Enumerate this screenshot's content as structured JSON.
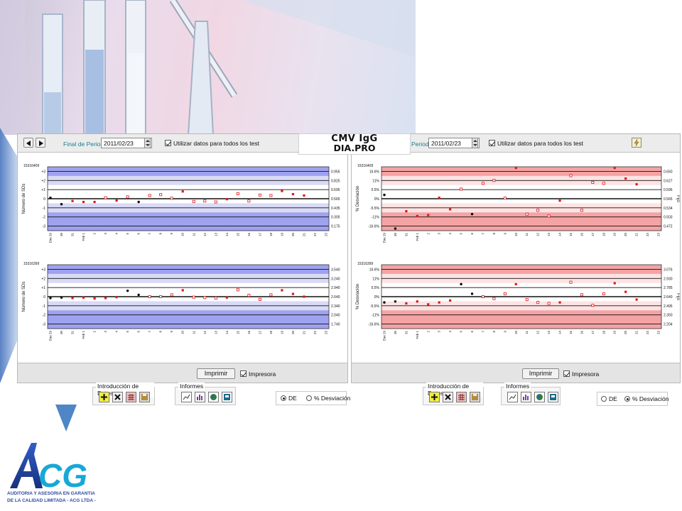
{
  "product": {
    "line1": "CMV IgG",
    "line2": "DIA.PRO"
  },
  "left_window": {
    "period_label": "Final de Periodo",
    "date_value": "2011/02/23",
    "use_all_label": "Utilizar datos para todos los test",
    "print_label": "Imprimir",
    "printer_label": "Impresora",
    "data_entry_title": "Introducción de Datos",
    "reports_title": "Informes",
    "radio_de": "DE",
    "radio_pct": "% Desviación",
    "selected_mode": "DE"
  },
  "right_window": {
    "period_label": "Periodo",
    "date_value": "2011/02/23",
    "use_all_label": "Utilizar datos para todos los test",
    "print_label": "Imprimir",
    "printer_label": "Impresora",
    "data_entry_title": "Introducción de Datos",
    "reports_title": "Informes",
    "radio_de": "DE",
    "radio_pct": "% Desviación",
    "selected_mode": "% Desviación"
  },
  "icons": {
    "prev": "arrow-left-icon",
    "next": "arrow-right-icon",
    "lightning": "lightning-icon",
    "add": "add-icon",
    "delete": "delete-icon",
    "grid": "grid-icon",
    "save": "save-icon",
    "chart": "line-chart-icon",
    "bar": "bar-chart-icon",
    "globe": "globe-icon",
    "report": "report-icon"
  },
  "colors": {
    "blue_band_dark": "#9ea2ef",
    "blue_band_light": "#d9daf6",
    "red_band": "#f4a3a4",
    "red_band_light": "#fde3e3",
    "point_red": "#e01818",
    "point_black": "#000000"
  },
  "logo": {
    "text": "ACG",
    "sub1": "AUDITORIA Y ASESORIA EN GARANTIA",
    "sub2": "DE LA CALIDAD LIMITADA - ACG LTDA -"
  },
  "chart_data": [
    {
      "type": "scatter",
      "panel": "left-top",
      "corner_label": "15316409",
      "ylabel": "Número de SDs",
      "y_ticks": [
        "+3",
        "+2",
        "+1",
        "0",
        "-1",
        "-2",
        "-3"
      ],
      "right_ticks": [
        "0.955",
        "0.825",
        "0.695",
        "0.565",
        "0.435",
        "0.305",
        "0.175"
      ],
      "x_ticks": [
        "Ene 29",
        "30",
        "31",
        "Feb 1",
        "2",
        "3",
        "4",
        "5",
        "6",
        "7",
        "8",
        "9",
        "10",
        "11",
        "12",
        "13",
        "14",
        "15",
        "16",
        "17",
        "18",
        "19",
        "20",
        "21",
        "22",
        "23"
      ],
      "ylim": [
        -3.5,
        3.5
      ],
      "points": [
        {
          "x": 0,
          "y": 0.1,
          "style": "black"
        },
        {
          "x": 1,
          "y": -0.6,
          "style": "black"
        },
        {
          "x": 2,
          "y": -0.25,
          "style": "red-filled"
        },
        {
          "x": 3,
          "y": -0.35,
          "style": "red-filled"
        },
        {
          "x": 4,
          "y": -0.35,
          "style": "red-filled"
        },
        {
          "x": 5,
          "y": 0.1,
          "style": "red-open"
        },
        {
          "x": 6,
          "y": -0.2,
          "style": "red-filled"
        },
        {
          "x": 7,
          "y": 0.2,
          "style": "red-open"
        },
        {
          "x": 8,
          "y": -0.35,
          "style": "black"
        },
        {
          "x": 9,
          "y": 0.35,
          "style": "red-open"
        },
        {
          "x": 10,
          "y": 0.45,
          "style": "red-open"
        },
        {
          "x": 11,
          "y": 0.05,
          "style": "red-open"
        },
        {
          "x": 12,
          "y": 0.8,
          "style": "red-filled"
        },
        {
          "x": 13,
          "y": -0.3,
          "style": "red-open"
        },
        {
          "x": 14,
          "y": -0.25,
          "style": "red-open"
        },
        {
          "x": 15,
          "y": -0.35,
          "style": "red-open"
        },
        {
          "x": 16,
          "y": -0.05,
          "style": "red-filled"
        },
        {
          "x": 17,
          "y": 0.55,
          "style": "red-open"
        },
        {
          "x": 18,
          "y": -0.25,
          "style": "red-open"
        },
        {
          "x": 19,
          "y": 0.4,
          "style": "red-open"
        },
        {
          "x": 20,
          "y": 0.35,
          "style": "red-open"
        },
        {
          "x": 21,
          "y": 0.85,
          "style": "red-filled"
        },
        {
          "x": 22,
          "y": 0.5,
          "style": "red-filled"
        },
        {
          "x": 23,
          "y": 0.35,
          "style": "red-filled"
        }
      ]
    },
    {
      "type": "scatter",
      "panel": "left-bottom",
      "corner_label": "15316399",
      "ylabel": "Número de SDs",
      "y_ticks": [
        "+3",
        "+2",
        "+1",
        "0",
        "-1",
        "-2",
        "-3"
      ],
      "right_ticks": [
        "3.540",
        "3.240",
        "2.940",
        "2.640",
        "2.340",
        "2.040",
        "1.740"
      ],
      "x_ticks": [
        "Ene 29",
        "30",
        "31",
        "Feb 1",
        "2",
        "3",
        "4",
        "5",
        "6",
        "7",
        "8",
        "9",
        "10",
        "11",
        "12",
        "13",
        "14",
        "15",
        "16",
        "17",
        "18",
        "19",
        "20",
        "21",
        "22",
        "23"
      ],
      "ylim": [
        -3.5,
        3.5
      ],
      "points": [
        {
          "x": 0,
          "y": -0.15,
          "style": "black"
        },
        {
          "x": 1,
          "y": -0.1,
          "style": "black"
        },
        {
          "x": 2,
          "y": -0.15,
          "style": "red-filled"
        },
        {
          "x": 3,
          "y": -0.1,
          "style": "red-filled"
        },
        {
          "x": 4,
          "y": -0.2,
          "style": "red-filled"
        },
        {
          "x": 5,
          "y": -0.15,
          "style": "red-filled"
        },
        {
          "x": 6,
          "y": -0.05,
          "style": "red-filled"
        },
        {
          "x": 7,
          "y": 0.65,
          "style": "black"
        },
        {
          "x": 8,
          "y": 0.2,
          "style": "black"
        },
        {
          "x": 9,
          "y": 0.0,
          "style": "red-open"
        },
        {
          "x": 10,
          "y": 0.0,
          "style": "red-open"
        },
        {
          "x": 11,
          "y": 0.2,
          "style": "red-open"
        },
        {
          "x": 12,
          "y": 0.7,
          "style": "red-filled"
        },
        {
          "x": 13,
          "y": -0.05,
          "style": "red-open"
        },
        {
          "x": 14,
          "y": -0.1,
          "style": "red-open"
        },
        {
          "x": 15,
          "y": -0.15,
          "style": "red-open"
        },
        {
          "x": 16,
          "y": -0.1,
          "style": "red-filled"
        },
        {
          "x": 17,
          "y": 0.75,
          "style": "red-open"
        },
        {
          "x": 18,
          "y": 0.15,
          "style": "red-open"
        },
        {
          "x": 19,
          "y": -0.3,
          "style": "red-open"
        },
        {
          "x": 20,
          "y": 0.2,
          "style": "red-open"
        },
        {
          "x": 21,
          "y": 0.7,
          "style": "red-filled"
        },
        {
          "x": 22,
          "y": 0.3,
          "style": "red-filled"
        },
        {
          "x": 23,
          "y": 0.0,
          "style": "red-filled"
        }
      ]
    },
    {
      "type": "scatter",
      "panel": "right-top",
      "corner_label": "15316409",
      "ylabel": "% Desviación",
      "right_axis_label": "Fijo",
      "y_ticks": [
        "16.6%",
        "11%",
        "5.5%",
        "0%",
        "-5.5%",
        "-11%",
        "-16.6%"
      ],
      "right_ticks": [
        "0.650",
        "0.627",
        "0.596",
        "0.565",
        "0.534",
        "0.503",
        "0.472"
      ],
      "x_ticks": [
        "Ene 29",
        "30",
        "31",
        "Feb 1",
        "2",
        "3",
        "4",
        "5",
        "6",
        "7",
        "8",
        "9",
        "10",
        "11",
        "12",
        "13",
        "14",
        "15",
        "16",
        "17",
        "18",
        "19",
        "20",
        "21",
        "22",
        "23"
      ],
      "ylim": [
        -16.6,
        16.6
      ],
      "points": [
        {
          "x": 0,
          "y": 2.0,
          "style": "black"
        },
        {
          "x": 1,
          "y": -15.5,
          "style": "black"
        },
        {
          "x": 2,
          "y": -6.5,
          "style": "red-filled"
        },
        {
          "x": 3,
          "y": -9.0,
          "style": "red-filled"
        },
        {
          "x": 4,
          "y": -8.5,
          "style": "red-filled"
        },
        {
          "x": 5,
          "y": 0.5,
          "style": "red-filled"
        },
        {
          "x": 6,
          "y": -5.5,
          "style": "red-filled"
        },
        {
          "x": 7,
          "y": 5.0,
          "style": "red-open"
        },
        {
          "x": 8,
          "y": -8.0,
          "style": "black"
        },
        {
          "x": 9,
          "y": 8.0,
          "style": "red-open"
        },
        {
          "x": 10,
          "y": 9.5,
          "style": "red-open"
        },
        {
          "x": 11,
          "y": 0.3,
          "style": "red-open"
        },
        {
          "x": 12,
          "y": 16.0,
          "style": "red-filled"
        },
        {
          "x": 13,
          "y": -8.0,
          "style": "red-open"
        },
        {
          "x": 14,
          "y": -6.0,
          "style": "red-open"
        },
        {
          "x": 15,
          "y": -9.0,
          "style": "red-open"
        },
        {
          "x": 16,
          "y": -1.0,
          "style": "red-filled"
        },
        {
          "x": 17,
          "y": 12.0,
          "style": "red-open"
        },
        {
          "x": 18,
          "y": -6.0,
          "style": "red-open"
        },
        {
          "x": 19,
          "y": 8.5,
          "style": "red-open"
        },
        {
          "x": 20,
          "y": 8.0,
          "style": "red-open"
        },
        {
          "x": 21,
          "y": 16.0,
          "style": "red-filled"
        },
        {
          "x": 22,
          "y": 10.5,
          "style": "red-filled"
        },
        {
          "x": 23,
          "y": 7.5,
          "style": "red-filled"
        }
      ]
    },
    {
      "type": "scatter",
      "panel": "right-bottom",
      "corner_label": "15316399",
      "ylabel": "% Desviación",
      "right_axis_label": "Fijo",
      "y_ticks": [
        "16.6%",
        "11%",
        "5.5%",
        "0%",
        "-5.5%",
        "-11%",
        "-16.6%"
      ],
      "right_ticks": [
        "3.076",
        "2.930",
        "2.785",
        "2.640",
        "2.495",
        "2.350",
        "2.204"
      ],
      "x_ticks": [
        "Ene 29",
        "30",
        "31",
        "Feb 1",
        "2",
        "3",
        "4",
        "5",
        "6",
        "7",
        "8",
        "9",
        "10",
        "11",
        "12",
        "13",
        "14",
        "15",
        "16",
        "17",
        "18",
        "19",
        "20",
        "21",
        "22",
        "23"
      ],
      "ylim": [
        -16.6,
        16.6
      ],
      "points": [
        {
          "x": 0,
          "y": -3.0,
          "style": "black"
        },
        {
          "x": 1,
          "y": -2.5,
          "style": "black"
        },
        {
          "x": 2,
          "y": -3.5,
          "style": "red-filled"
        },
        {
          "x": 3,
          "y": -2.5,
          "style": "red-filled"
        },
        {
          "x": 4,
          "y": -4.0,
          "style": "red-filled"
        },
        {
          "x": 5,
          "y": -3.0,
          "style": "red-filled"
        },
        {
          "x": 6,
          "y": -2.0,
          "style": "red-filled"
        },
        {
          "x": 7,
          "y": 6.5,
          "style": "black"
        },
        {
          "x": 8,
          "y": 1.5,
          "style": "black"
        },
        {
          "x": 9,
          "y": 0.0,
          "style": "red-open"
        },
        {
          "x": 10,
          "y": -1.0,
          "style": "red-open"
        },
        {
          "x": 11,
          "y": 1.5,
          "style": "red-open"
        },
        {
          "x": 12,
          "y": 6.5,
          "style": "red-filled"
        },
        {
          "x": 13,
          "y": -1.5,
          "style": "red-open"
        },
        {
          "x": 14,
          "y": -3.0,
          "style": "red-open"
        },
        {
          "x": 15,
          "y": -3.5,
          "style": "red-open"
        },
        {
          "x": 16,
          "y": -3.0,
          "style": "red-filled"
        },
        {
          "x": 17,
          "y": 7.5,
          "style": "red-open"
        },
        {
          "x": 18,
          "y": 1.0,
          "style": "red-open"
        },
        {
          "x": 19,
          "y": -4.5,
          "style": "red-open"
        },
        {
          "x": 20,
          "y": 1.5,
          "style": "red-open"
        },
        {
          "x": 21,
          "y": 7.0,
          "style": "red-filled"
        },
        {
          "x": 22,
          "y": 2.5,
          "style": "red-filled"
        },
        {
          "x": 23,
          "y": -1.5,
          "style": "red-filled"
        }
      ]
    }
  ]
}
